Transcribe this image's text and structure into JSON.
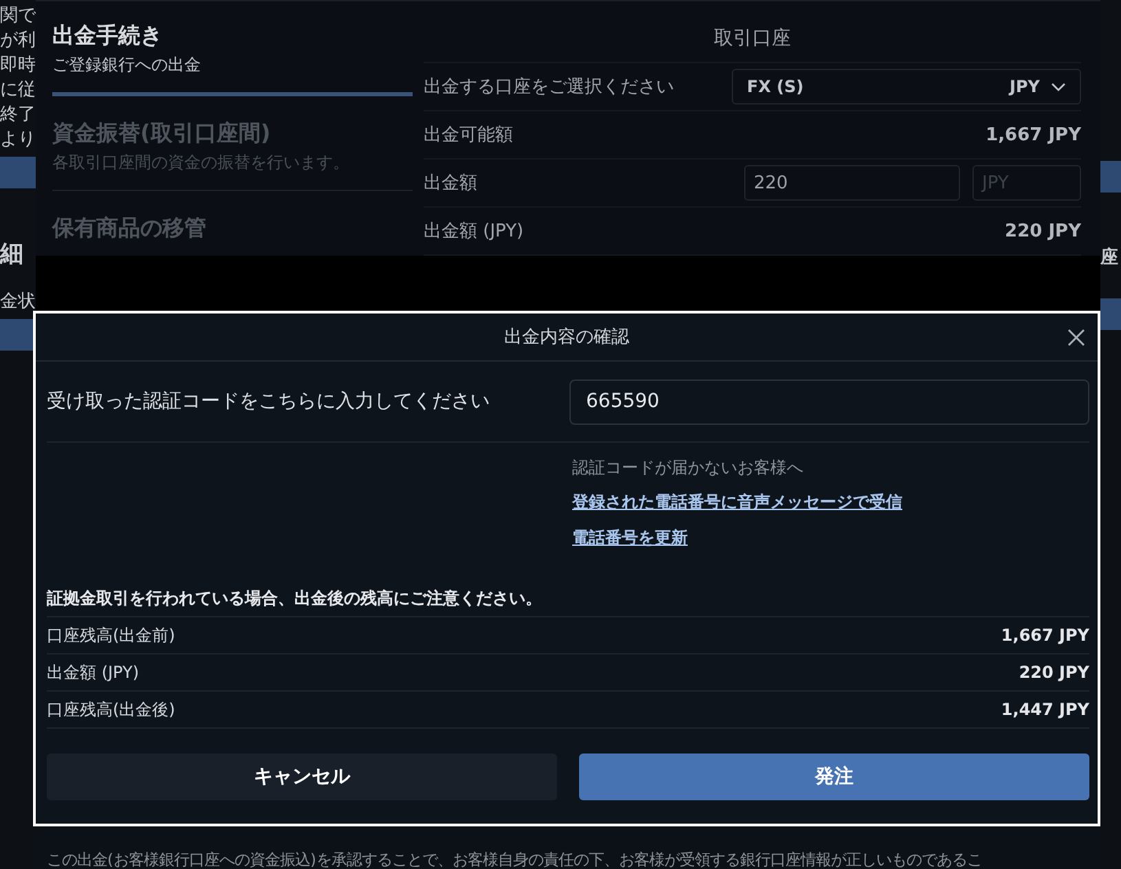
{
  "background_left": [
    {
      "kind": "text",
      "text": "関で"
    },
    {
      "kind": "text",
      "text": "が利"
    },
    {
      "kind": "text",
      "text": "即時"
    },
    {
      "kind": "text",
      "text": "に従"
    },
    {
      "kind": "text",
      "text": "終了"
    },
    {
      "kind": "text",
      "text": "より"
    },
    {
      "kind": "bar"
    },
    {
      "kind": "heading",
      "text": "細"
    },
    {
      "kind": "text",
      "text": "金状"
    },
    {
      "kind": "bar"
    }
  ],
  "background_right": [
    {
      "kind": "bar"
    },
    {
      "kind": "heading",
      "text": "座"
    },
    {
      "kind": "bar"
    }
  ],
  "nav": [
    {
      "title": "出金手続き",
      "subtitle": "ご登録銀行への出金",
      "selected": true
    },
    {
      "title": "資金振替(取引口座間)",
      "subtitle": "各取引口座間の資金の振替を行います。",
      "selected": false
    },
    {
      "title": "保有商品の移管",
      "selected": false
    }
  ],
  "account_panel": {
    "title": "取引口座",
    "account_select": {
      "label": "出金する口座をご選択ください",
      "value": "FX (S)",
      "currency": "JPY"
    },
    "available": {
      "label": "出金可能額",
      "value": "1,667 JPY"
    },
    "amount": {
      "label": "出金額",
      "value": "220",
      "currency_placeholder": "JPY"
    },
    "amount_jpy": {
      "label": "出金額 (JPY)",
      "value": "220 JPY"
    }
  },
  "dialog": {
    "title": "出金内容の確認",
    "code": {
      "label": "受け取った認証コードをこちらに入力してください",
      "value": "665590"
    },
    "help_text": "認証コードが届かないお客様へ",
    "links": [
      "登録された電話番号に音声メッセージで受信",
      "電話番号を更新"
    ],
    "warning": "証拠金取引を行われている場合、出金後の残高にご注意ください。",
    "summary": [
      {
        "label": "口座残高(出金前)",
        "value": "1,667 JPY"
      },
      {
        "label": "出金額 (JPY)",
        "value": "220 JPY"
      },
      {
        "label": "口座残高(出金後)",
        "value": "1,447 JPY"
      }
    ],
    "buttons": [
      {
        "kind": "secondary",
        "label": "キャンセル"
      },
      {
        "kind": "primary",
        "label": "発注"
      }
    ]
  },
  "footer_text": "この出金(お客様銀行口座への資金振込)を承認することで、お客様自身の責任の下、お客様が受領する銀行口座情報が正しいものであるこ"
}
